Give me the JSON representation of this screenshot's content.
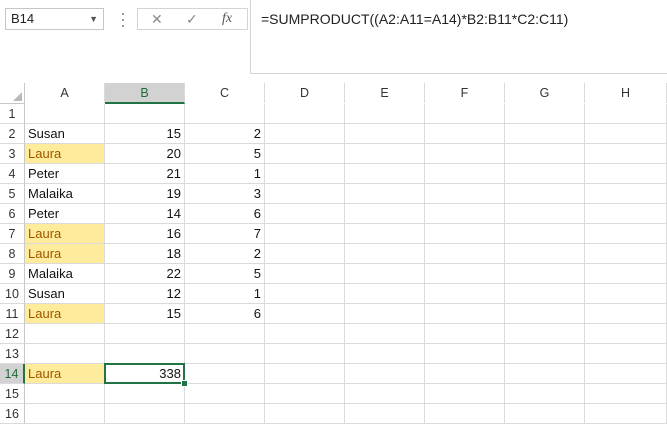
{
  "namebox": {
    "value": "B14"
  },
  "formula_bar": {
    "cancel_glyph": "✕",
    "enter_glyph": "✓",
    "fx_label": "fx",
    "formula": "=SUMPRODUCT((A2:A11=A14)*B2:B11*C2:C11)"
  },
  "columns": [
    "A",
    "B",
    "C",
    "D",
    "E",
    "F",
    "G",
    "H"
  ],
  "rows": [
    "1",
    "2",
    "3",
    "4",
    "5",
    "6",
    "7",
    "8",
    "9",
    "10",
    "11",
    "12",
    "13",
    "14",
    "15",
    "16"
  ],
  "cells": {
    "A2": "Susan",
    "B2": "15",
    "C2": "2",
    "A3": "Laura",
    "B3": "20",
    "C3": "5",
    "A4": "Peter",
    "B4": "21",
    "C4": "1",
    "A5": "Malaika",
    "B5": "19",
    "C5": "3",
    "A6": "Peter",
    "B6": "14",
    "C6": "6",
    "A7": "Laura",
    "B7": "16",
    "C7": "7",
    "A8": "Laura",
    "B8": "18",
    "C8": "2",
    "A9": "Malaika",
    "B9": "22",
    "C9": "5",
    "A10": "Susan",
    "B10": "12",
    "C10": "1",
    "A11": "Laura",
    "B11": "15",
    "C11": "6",
    "A14": "Laura",
    "B14": "338"
  },
  "highlighted_cells": [
    "A3",
    "A7",
    "A8",
    "A11",
    "A14"
  ],
  "selected_cell": "B14",
  "colors": {
    "highlight_fill": "#ffeb9c",
    "highlight_text": "#9c5700",
    "selection": "#217346"
  }
}
